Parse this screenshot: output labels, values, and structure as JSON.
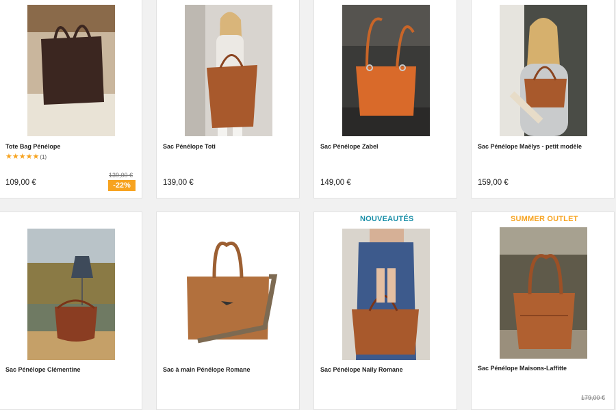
{
  "products": [
    {
      "name": "Tote Bag Pénélope",
      "price": "109,00 €",
      "old_price": "139,00 €",
      "discount": "-22%",
      "rating_count": "(1)",
      "stars": "★★★★★"
    },
    {
      "name": "Sac Pénélope Toti",
      "price": "139,00 €"
    },
    {
      "name": "Sac Pénélope Zabel",
      "price": "149,00 €"
    },
    {
      "name": "Sac Pénélope Maëlys - petit modèle",
      "price": "159,00 €"
    },
    {
      "name": "Sac Pénélope Clémentine"
    },
    {
      "name": "Sac à main Pénélope Romane"
    },
    {
      "name": "Sac Pénélope Naily Romane",
      "flag": "NOUVEAUTÉS"
    },
    {
      "name": "Sac Pénélope Maisons-Laffitte",
      "flag": "SUMMER OUTLET",
      "old_price": "179,00 €"
    }
  ],
  "colors": {
    "accent_orange": "#f7a31f",
    "flag_new": "#1a8fa8",
    "flag_outlet": "#f7a31f",
    "leather": "#a8592c"
  }
}
